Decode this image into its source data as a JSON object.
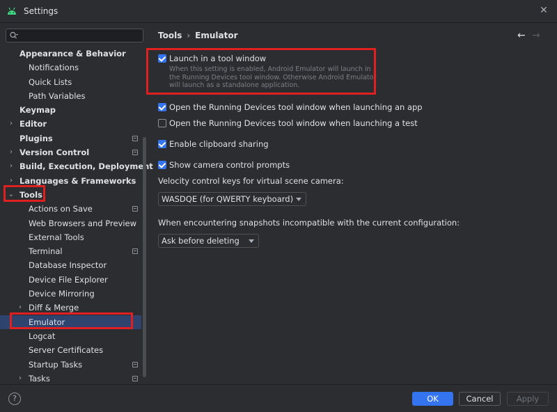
{
  "window": {
    "title": "Settings"
  },
  "sidebar": {
    "search_placeholder": "",
    "items": [
      {
        "label": "Appearance & Behavior",
        "level": 0,
        "bold": true,
        "arrow": "",
        "pin": false
      },
      {
        "label": "Notifications",
        "level": 1,
        "bold": false,
        "arrow": "",
        "pin": false
      },
      {
        "label": "Quick Lists",
        "level": 1,
        "bold": false,
        "arrow": "",
        "pin": false
      },
      {
        "label": "Path Variables",
        "level": 1,
        "bold": false,
        "arrow": "",
        "pin": false
      },
      {
        "label": "Keymap",
        "level": 0,
        "bold": true,
        "arrow": "",
        "pin": false
      },
      {
        "label": "Editor",
        "level": 0,
        "bold": true,
        "arrow": "›",
        "pin": false
      },
      {
        "label": "Plugins",
        "level": 0,
        "bold": true,
        "arrow": "",
        "pin": true
      },
      {
        "label": "Version Control",
        "level": 0,
        "bold": true,
        "arrow": "›",
        "pin": true
      },
      {
        "label": "Build, Execution, Deployment",
        "level": 0,
        "bold": true,
        "arrow": "›",
        "pin": false
      },
      {
        "label": "Languages & Frameworks",
        "level": 0,
        "bold": true,
        "arrow": "›",
        "pin": false
      },
      {
        "label": "Tools",
        "level": 0,
        "bold": true,
        "arrow": "⌄",
        "pin": false
      },
      {
        "label": "Actions on Save",
        "level": 1,
        "bold": false,
        "arrow": "",
        "pin": true
      },
      {
        "label": "Web Browsers and Preview",
        "level": 1,
        "bold": false,
        "arrow": "",
        "pin": false
      },
      {
        "label": "External Tools",
        "level": 1,
        "bold": false,
        "arrow": "",
        "pin": false
      },
      {
        "label": "Terminal",
        "level": 1,
        "bold": false,
        "arrow": "",
        "pin": true
      },
      {
        "label": "Database Inspector",
        "level": 1,
        "bold": false,
        "arrow": "",
        "pin": false
      },
      {
        "label": "Device File Explorer",
        "level": 1,
        "bold": false,
        "arrow": "",
        "pin": false
      },
      {
        "label": "Device Mirroring",
        "level": 1,
        "bold": false,
        "arrow": "",
        "pin": false
      },
      {
        "label": "Diff & Merge",
        "level": 1,
        "bold": false,
        "arrow": "›",
        "pin": false
      },
      {
        "label": "Emulator",
        "level": 1,
        "bold": false,
        "arrow": "",
        "pin": false,
        "selected": true
      },
      {
        "label": "Logcat",
        "level": 1,
        "bold": false,
        "arrow": "",
        "pin": false
      },
      {
        "label": "Server Certificates",
        "level": 1,
        "bold": false,
        "arrow": "",
        "pin": false
      },
      {
        "label": "Startup Tasks",
        "level": 1,
        "bold": false,
        "arrow": "",
        "pin": true
      },
      {
        "label": "Tasks",
        "level": 1,
        "bold": false,
        "arrow": "›",
        "pin": true
      }
    ]
  },
  "breadcrumb": {
    "parent": "Tools",
    "sep": "›",
    "current": "Emulator"
  },
  "nav": {
    "back": "←",
    "forward": "→"
  },
  "settings": {
    "launch_tool_window": {
      "label": "Launch in a tool window",
      "checked": true,
      "description": "When this setting is enabled, Android Emulator will launch in the Running Devices tool window. Otherwise Android Emulator will launch as a standalone application."
    },
    "open_running_devices_app": {
      "label": "Open the Running Devices tool window when launching an app",
      "checked": true
    },
    "open_running_devices_test": {
      "label": "Open the Running Devices tool window when launching a test",
      "checked": false
    },
    "clipboard_sharing": {
      "label": "Enable clipboard sharing",
      "checked": true
    },
    "camera_prompts": {
      "label": "Show camera control prompts",
      "checked": true
    },
    "velocity_keys": {
      "label": "Velocity control keys for virtual scene camera:",
      "value": "WASDQE (for QWERTY keyboard)"
    },
    "snapshots": {
      "label": "When encountering snapshots incompatible with the current configuration:",
      "value": "Ask before deleting"
    }
  },
  "footer": {
    "help": "?",
    "ok": "OK",
    "cancel": "Cancel",
    "apply": "Apply"
  },
  "colors": {
    "accent": "#3574f0",
    "highlight": "#e02020",
    "selected_row": "#2e436e",
    "background": "#2b2d30"
  }
}
